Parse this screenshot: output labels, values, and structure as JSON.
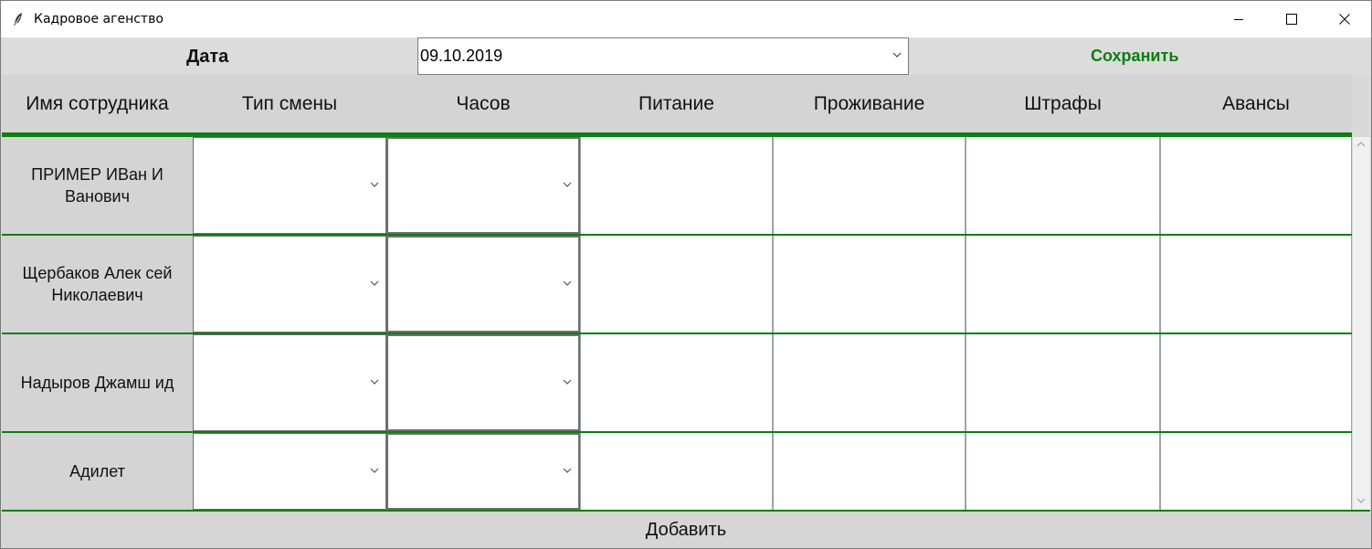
{
  "window": {
    "title": "Кадровое агенство"
  },
  "datebar": {
    "label": "Дата",
    "date_value": "09.10.2019",
    "save_label": "Сохранить"
  },
  "header": {
    "columns": [
      "Имя сотрудника",
      "Тип смены",
      "Часов",
      "Питание",
      "Проживание",
      "Штрафы",
      "Авансы"
    ]
  },
  "rows": [
    {
      "name": "ПРИМЕР ИВан И Ванович",
      "shift_type": "",
      "hours": "",
      "food": "",
      "housing": "",
      "fines": "",
      "advances": ""
    },
    {
      "name": "Щербаков Алек сей Николаевич",
      "shift_type": "",
      "hours": "",
      "food": "",
      "housing": "",
      "fines": "",
      "advances": ""
    },
    {
      "name": "Надыров Джамш ид",
      "shift_type": "",
      "hours": "",
      "food": "",
      "housing": "",
      "fines": "",
      "advances": ""
    },
    {
      "name": "Адилет",
      "shift_type": "",
      "hours": "",
      "food": "",
      "housing": "",
      "fines": "",
      "advances": ""
    }
  ],
  "footer": {
    "add_label": "Добавить"
  },
  "colors": {
    "accent_green": "#0a7e12",
    "panel_gray": "#d4d4d4"
  },
  "icons": {
    "app": "feather-icon",
    "minimize": "minimize-icon",
    "maximize": "maximize-icon",
    "close": "close-icon",
    "dropdown": "chevron-down-icon",
    "scroll_up": "chevron-up-icon",
    "scroll_down": "chevron-down-icon"
  }
}
